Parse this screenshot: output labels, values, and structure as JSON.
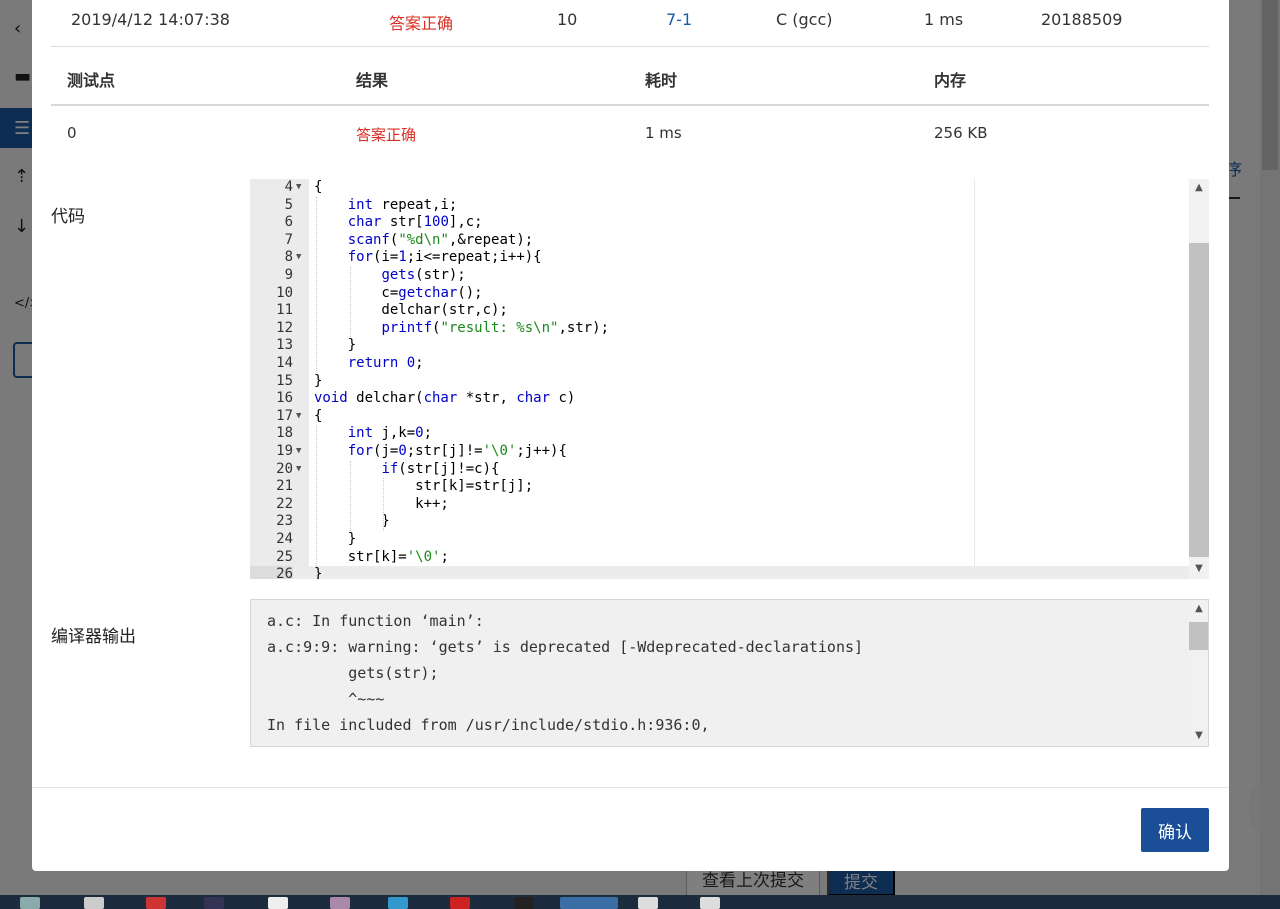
{
  "submission": {
    "time": "2019/4/12 14:07:38",
    "status": "答案正确",
    "score": "10",
    "problem": "7-1",
    "compiler": "C (gcc)",
    "duration": "1 ms",
    "user": "20188509"
  },
  "testpoints": {
    "headers": [
      "测试点",
      "结果",
      "耗时",
      "内存"
    ],
    "rows": [
      {
        "id": "0",
        "result": "答案正确",
        "time": "1 ms",
        "memory": "256 KB"
      }
    ]
  },
  "labels": {
    "code": "代码",
    "compiler_output": "编译器输出"
  },
  "code_lines": [
    {
      "n": "4",
      "text": "{"
    },
    {
      "n": "5",
      "text": "    int repeat,i;"
    },
    {
      "n": "6",
      "text": "    char str[100],c;"
    },
    {
      "n": "7",
      "text": "    scanf(\"%d\\n\",&repeat);"
    },
    {
      "n": "8",
      "text": "    for(i=1;i<=repeat;i++){"
    },
    {
      "n": "9",
      "text": "        gets(str);"
    },
    {
      "n": "10",
      "text": "        c=getchar();"
    },
    {
      "n": "11",
      "text": "        delchar(str,c);"
    },
    {
      "n": "12",
      "text": "        printf(\"result: %s\\n\",str);"
    },
    {
      "n": "13",
      "text": "    }"
    },
    {
      "n": "14",
      "text": "    return 0;"
    },
    {
      "n": "15",
      "text": "}"
    },
    {
      "n": "16",
      "text": "void delchar(char *str, char c)"
    },
    {
      "n": "17",
      "text": "{"
    },
    {
      "n": "18",
      "text": "    int j,k=0;"
    },
    {
      "n": "19",
      "text": "    for(j=0;str[j]!='\\0';j++){"
    },
    {
      "n": "20",
      "text": "        if(str[j]!=c){"
    },
    {
      "n": "21",
      "text": "            str[k]=str[j];"
    },
    {
      "n": "22",
      "text": "            k++;"
    },
    {
      "n": "23",
      "text": "        }"
    },
    {
      "n": "24",
      "text": "    }"
    },
    {
      "n": "25",
      "text": "    str[k]='\\0';"
    },
    {
      "n": "26",
      "text": "}"
    }
  ],
  "compiler_output": [
    "a.c: In function ‘main’:",
    "a.c:9:9: warning: ‘gets’ is deprecated [-Wdeprecated-declarations]",
    "         gets(str);",
    "         ^~~~",
    "In file included from /usr/include/stdio.h:936:0,"
  ],
  "buttons": {
    "confirm": "确认",
    "view_last": "查看上次提交",
    "submit": "提交"
  },
  "background": {
    "right_tab": "序"
  },
  "colors": {
    "primary": "#1a4f97",
    "accepted": "#d93025"
  }
}
